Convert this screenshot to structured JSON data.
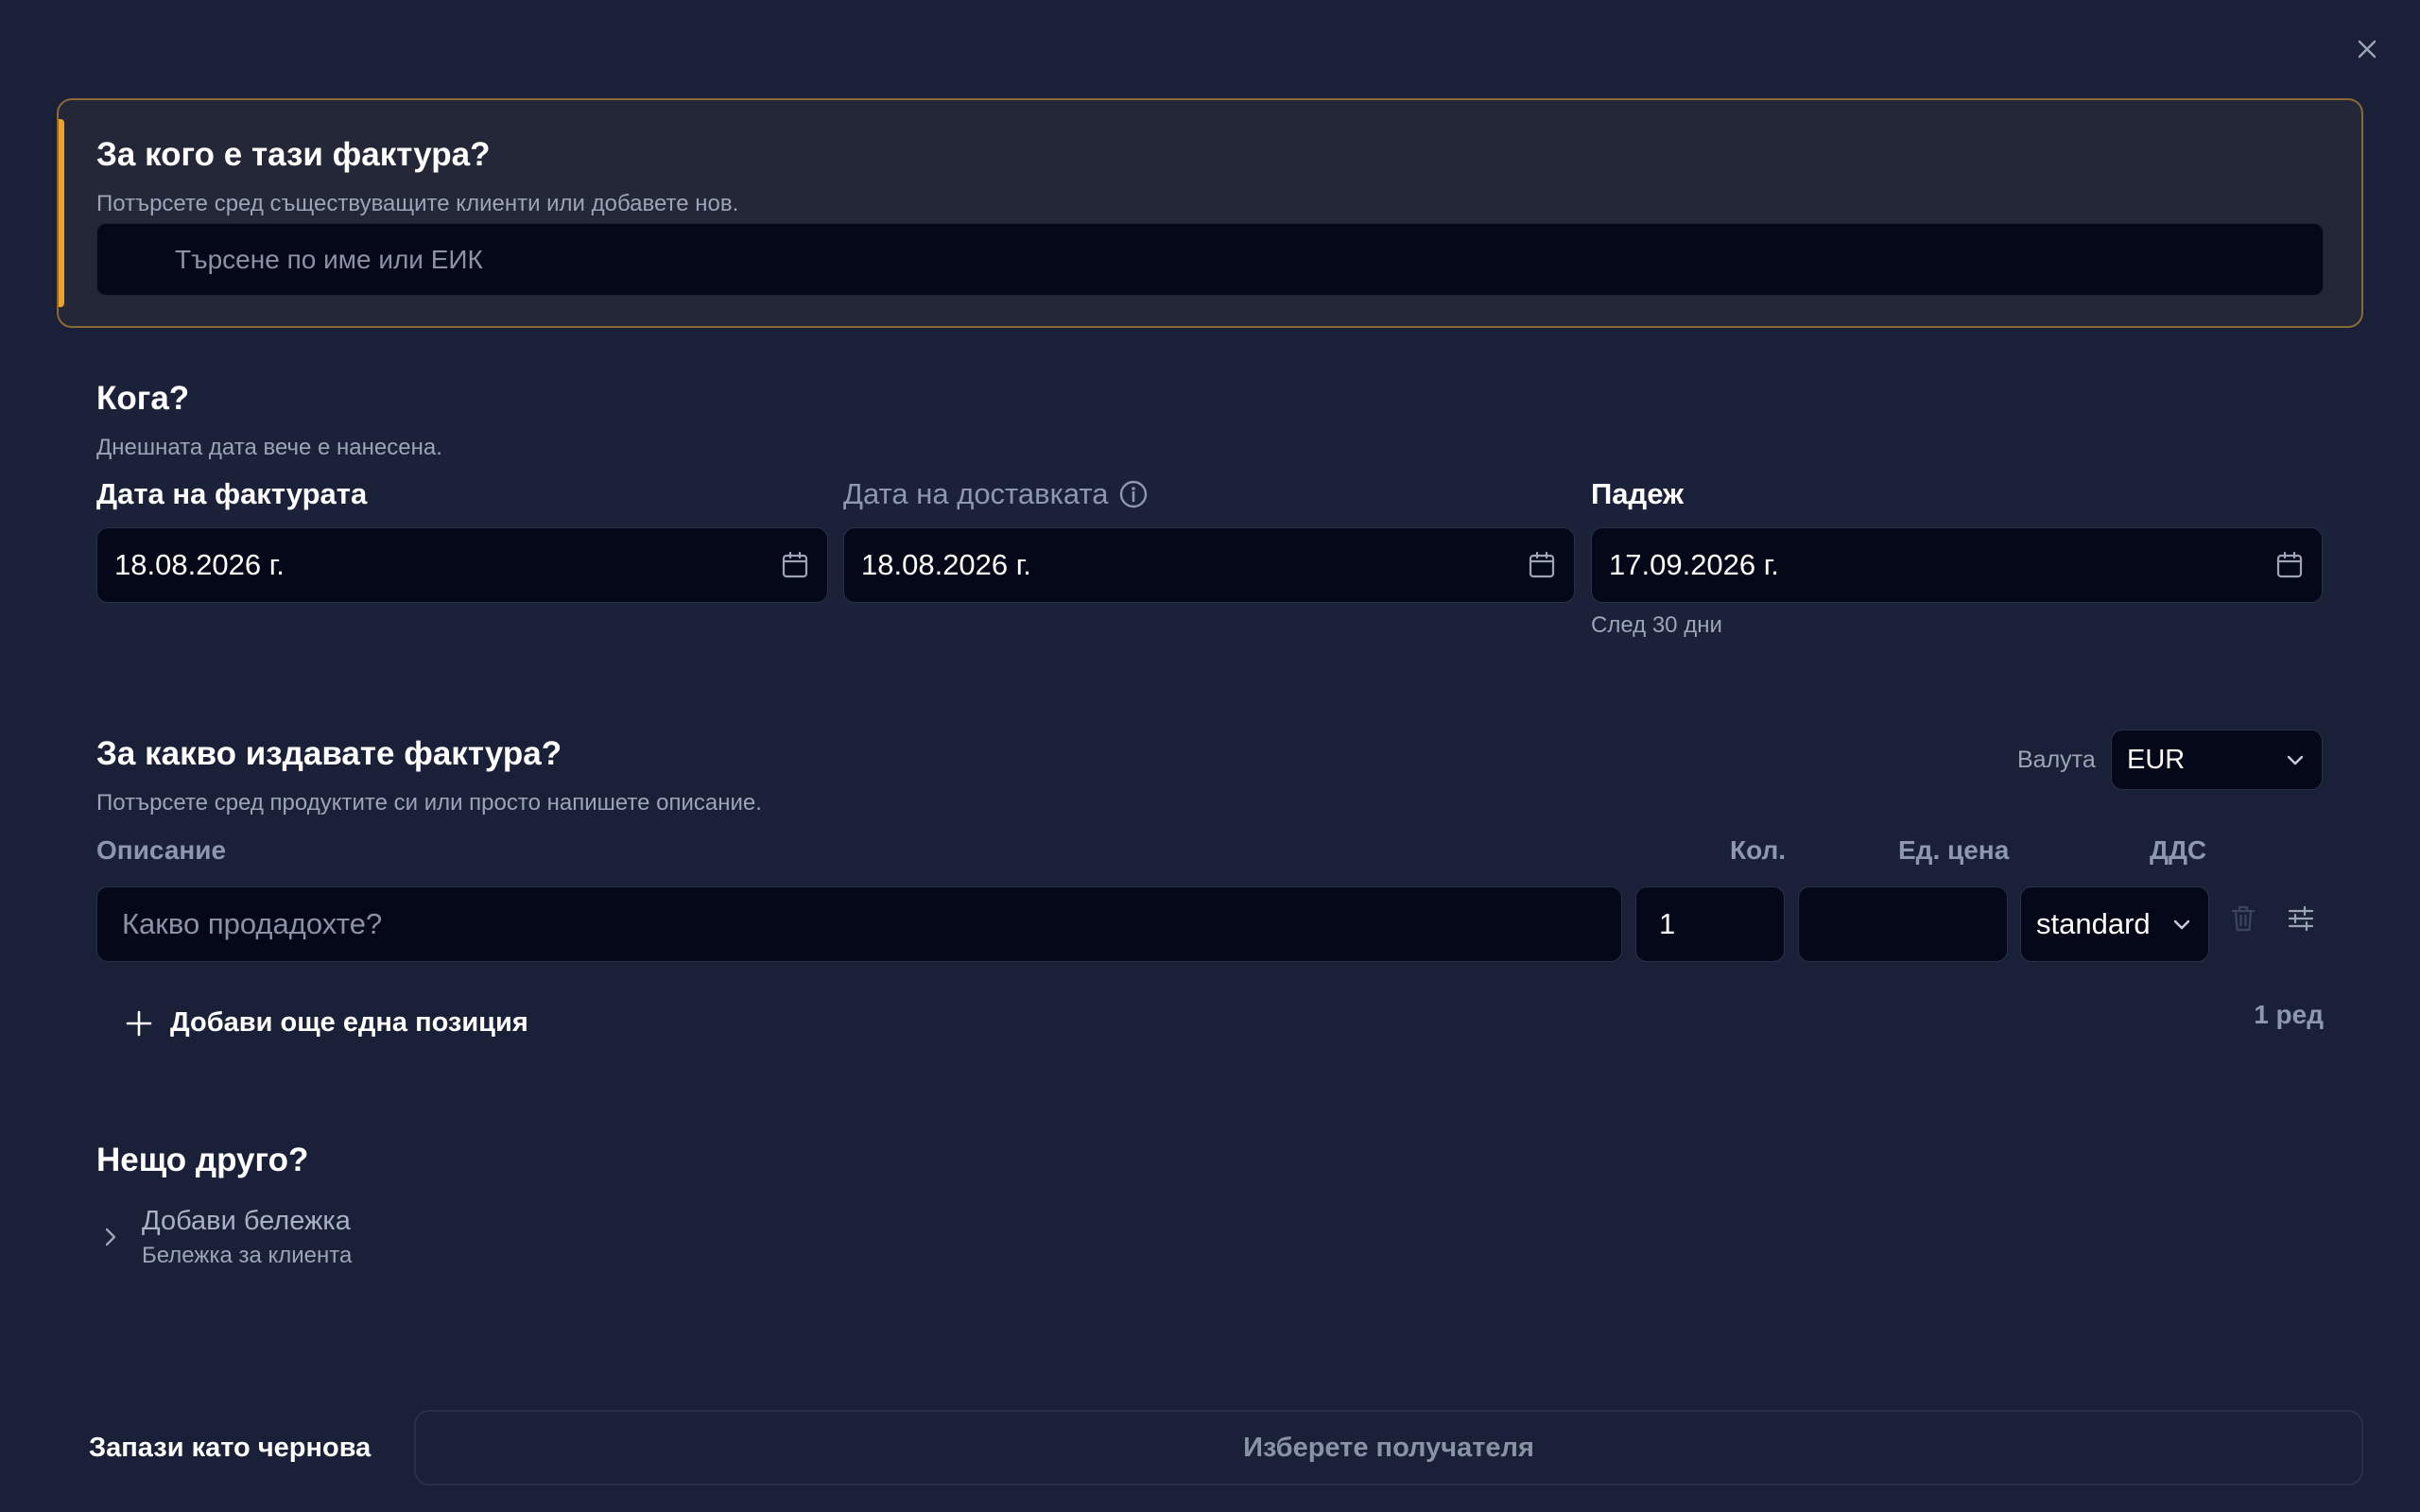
{
  "client": {
    "title": "За кого е тази фактура?",
    "subtitle": "Потърсете сред съществуващите клиенти или добавете нов.",
    "search_placeholder": "Търсене по име или ЕИК"
  },
  "when": {
    "title": "Кога?",
    "subtitle": "Днешната дата вече е нанесена.",
    "invoice_date_label": "Дата на фактурата",
    "invoice_date": "18.08.2026 г.",
    "delivery_date_label": "Дата на доставката",
    "delivery_date": "18.08.2026 г.",
    "due_label": "Падеж",
    "due_date": "17.09.2026 г.",
    "due_helper": "След 30 дни"
  },
  "items": {
    "title": "За какво издавате фактура?",
    "subtitle": "Потърсете сред продуктите си или просто напишете описание.",
    "currency_label": "Валута",
    "currency": "EUR",
    "columns": {
      "description": "Описание",
      "qty": "Кол.",
      "unit_price": "Ед. цена",
      "vat": "ДДС"
    },
    "rows": [
      {
        "description_placeholder": "Какво продадохте?",
        "qty": "1",
        "unit_price": "",
        "vat": "standard"
      }
    ],
    "add_line_label": "Добави още една позиция",
    "row_count": "1 ред"
  },
  "other": {
    "title": "Нещо друго?",
    "note_title": "Добави бележка",
    "note_subtitle": "Бележка за клиента"
  },
  "footer": {
    "draft_label": "Запази като чернова",
    "submit_label": "Изберете получателя"
  },
  "colors": {
    "background": "#1a2038",
    "input_bg": "#050818",
    "accent": "#f0a12a",
    "muted_text": "#9ca4b8"
  },
  "icons": {
    "close": "close-icon",
    "calendar": "calendar-icon",
    "info": "info-icon",
    "chevron": "chevron-down-icon",
    "trash": "trash-icon",
    "settings": "sliders-icon",
    "plus": "plus-icon",
    "chevron_right": "chevron-right-icon"
  }
}
